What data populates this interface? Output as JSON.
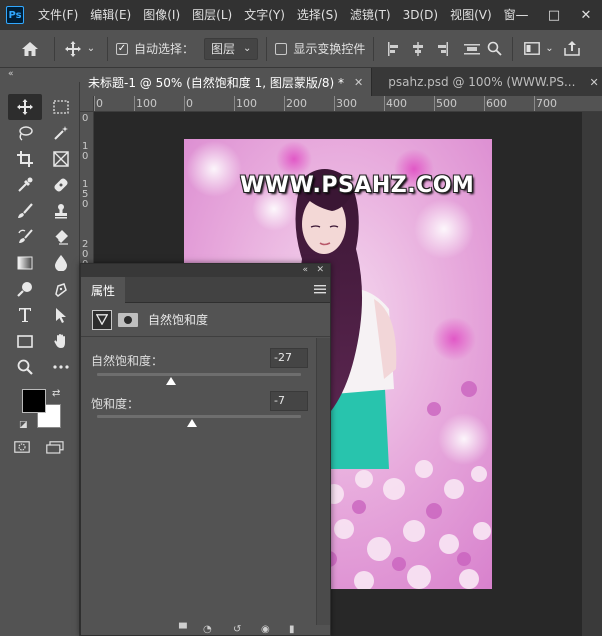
{
  "app": {
    "logo": "Ps"
  },
  "menu": [
    "文件(F)",
    "编辑(E)",
    "图像(I)",
    "图层(L)",
    "文字(Y)",
    "选择(S)",
    "滤镜(T)",
    "3D(D)",
    "视图(V)",
    "窗"
  ],
  "window_controls": {
    "minimize": "—",
    "maximize": "□",
    "close": "✕"
  },
  "options": {
    "auto_select_label": "自动选择：",
    "auto_select_checked": true,
    "auto_select_value": "图层",
    "show_transform_label": "显示变换控件",
    "show_transform_checked": false
  },
  "tabs": [
    {
      "label": "未标题-1 @ 50% (自然饱和度 1, 图层蒙版/8) *",
      "active": true
    },
    {
      "label": "psahz.psd @ 100% (WWW.PS...",
      "active": false
    }
  ],
  "ruler": {
    "h_labels": [
      "0",
      "100",
      "0",
      "100",
      "200",
      "300",
      "400",
      "500",
      "600",
      "700"
    ],
    "v_labels": [
      "0",
      "1",
      "0",
      "1",
      "5",
      "0",
      "2",
      "0",
      "0"
    ]
  },
  "image": {
    "watermark": "WWW.PSAHZ.COM"
  },
  "properties": {
    "panel_title": "属性",
    "adjustment_name": "自然饱和度",
    "vibrance_label": "自然饱和度：",
    "vibrance_value": "-27",
    "vibrance_slider_fraction": 0.365,
    "saturation_label": "饱和度：",
    "saturation_value": "-7",
    "saturation_slider_fraction": 0.465
  },
  "colors": {
    "foreground": "#000000",
    "background": "#ffffff",
    "ui_dark": "#323232",
    "ui_mid": "#535353",
    "canvas_bg": "#282828"
  }
}
